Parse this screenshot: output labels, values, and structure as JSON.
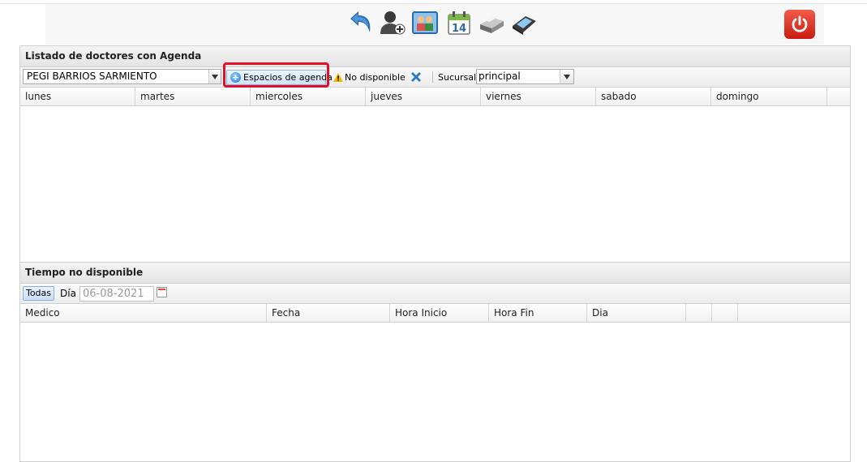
{
  "panel1": {
    "title": "Listado de doctores con Agenda",
    "doctor_select_value": "PEGI BARRIOS SARMIENTO",
    "espacios_button": "Espacios de agenda",
    "no_disponible_label": "No disponible",
    "sucursal_label": "Sucursal:",
    "sucursal_value": "principal",
    "days": [
      "lunes",
      "martes",
      "miercoles",
      "jueves",
      "viernes",
      "sabado",
      "domingo"
    ]
  },
  "panel2": {
    "title": "Tiempo no disponible",
    "todas_button": "Todas",
    "dia_label": "Día",
    "dia_value": "06-08-2021",
    "columns": [
      "Medico",
      "Fecha",
      "Hora Inicio",
      "Hora Fin",
      "Dia",
      "",
      ""
    ]
  },
  "toolbar_icons": [
    "back-icon",
    "add-user-icon",
    "users-group-icon",
    "calendar-icon",
    "printer-icon",
    "register-icon",
    "power-icon"
  ],
  "colors": {
    "highlight": "#e0102c",
    "power": "#d9281b",
    "button_blue": "#cfe2f7"
  }
}
